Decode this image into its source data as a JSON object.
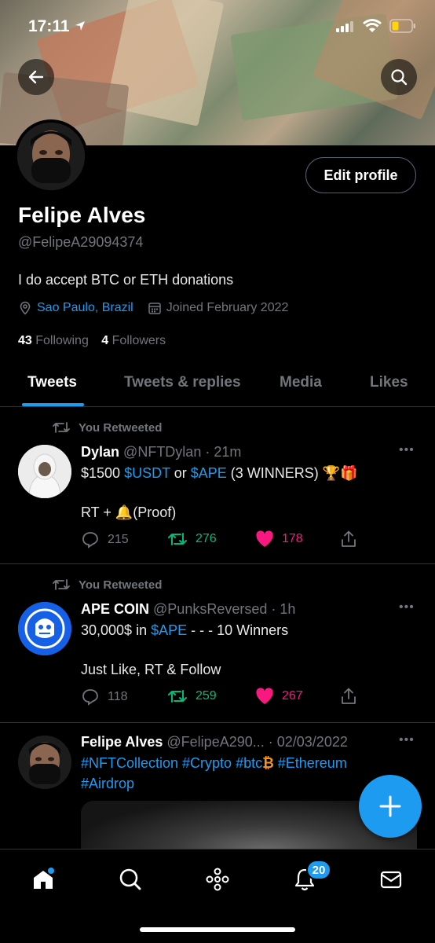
{
  "status_bar": {
    "time": "17:11"
  },
  "profile": {
    "name": "Felipe Alves",
    "handle": "@FelipeA29094374",
    "bio": "I do accept BTC or ETH donations",
    "location": "Sao Paulo, Brazil",
    "joined": "Joined February 2022",
    "following_count": "43",
    "following_label": "Following",
    "followers_count": "4",
    "followers_label": "Followers",
    "edit_label": "Edit profile"
  },
  "tabs": [
    {
      "label": "Tweets",
      "active": true
    },
    {
      "label": "Tweets & replies",
      "active": false
    },
    {
      "label": "Media",
      "active": false
    },
    {
      "label": "Likes",
      "active": false
    }
  ],
  "tweets": [
    {
      "retweet_label": "You Retweeted",
      "name": "Dylan",
      "handle": "@NFTDylan",
      "time": "· 21m",
      "body_pre": "$1500 ",
      "link1": "$USDT",
      "mid": " or ",
      "link2": "$APE",
      "body_post": " (3 WINNERS) 🏆🎁",
      "body2": "RT + 🔔(Proof)",
      "replies": "215",
      "retweets": "276",
      "likes": "178"
    },
    {
      "retweet_label": "You Retweeted",
      "name": "APE COIN",
      "handle": "@PunksReversed",
      "time": "· 1h",
      "body_pre": "30,000$ in ",
      "link1": "$APE",
      "body_post": " - - - 10 Winners",
      "body2": "Just Like, RT & Follow",
      "replies": "118",
      "retweets": "259",
      "likes": "267"
    },
    {
      "name": "Felipe Alves",
      "handle": "@FelipeA290...",
      "time": "· 02/03/2022",
      "tags1": "#NFTCollection #Crypto #btc",
      "btc_glyph": "₿",
      "tags1b": " #Ethereum",
      "tags2": "#Airdrop"
    }
  ],
  "nav": {
    "notification_badge": "20"
  },
  "colors": {
    "accent": "#1d9bf0",
    "retweet_green": "#00ba7c",
    "like_pink": "#f91880",
    "text_secondary": "#71767b"
  }
}
